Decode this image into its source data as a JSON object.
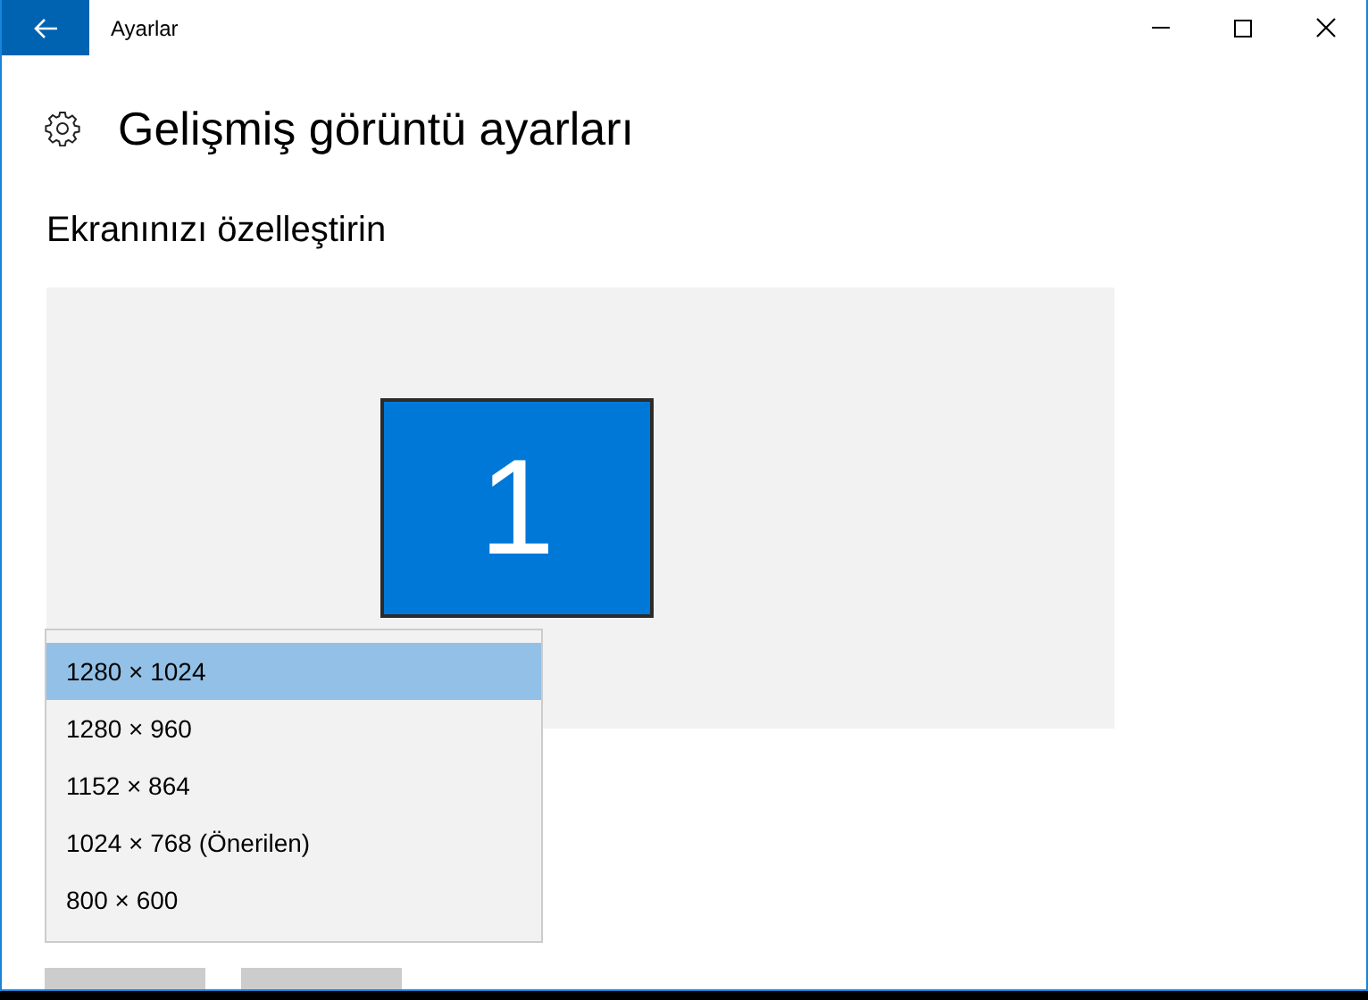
{
  "window": {
    "title": "Ayarlar"
  },
  "page": {
    "title": "Gelişmiş görüntü ayarları"
  },
  "section": {
    "title": "Ekranınızı özelleştirin"
  },
  "display": {
    "label": "1"
  },
  "resolution_menu": {
    "options": [
      {
        "label": "1280 × 1024",
        "selected": true
      },
      {
        "label": "1280 × 960",
        "selected": false
      },
      {
        "label": "1152 × 864",
        "selected": false
      },
      {
        "label": "1024 × 768 (Önerilen)",
        "selected": false
      },
      {
        "label": "800 × 600",
        "selected": false
      }
    ]
  }
}
